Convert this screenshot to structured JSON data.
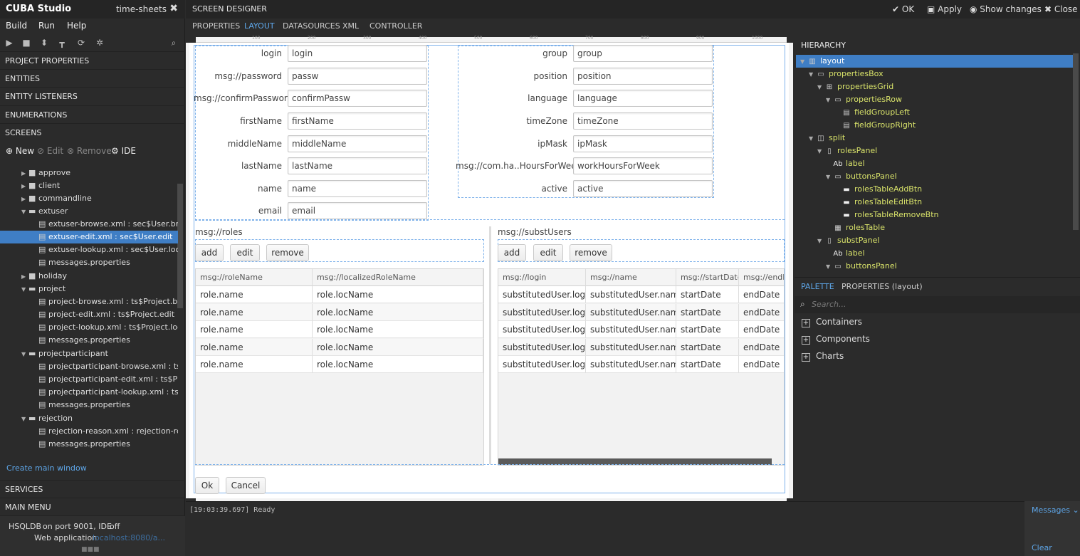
{
  "app": {
    "title": "CUBA Studio",
    "project_name": "time-sheets",
    "close_glyph": "✖"
  },
  "menu": {
    "build": "Build",
    "run": "Run",
    "help": "Help"
  },
  "left_sections": {
    "project_properties": "PROJECT PROPERTIES",
    "entities": "ENTITIES",
    "entity_listeners": "ENTITY LISTENERS",
    "enumerations": "ENUMERATIONS",
    "screens": "SCREENS",
    "services": "SERVICES",
    "main_menu": "MAIN MENU"
  },
  "screen_actions": {
    "new": "New",
    "edit": "Edit",
    "remove": "Remove",
    "ide": "IDE"
  },
  "tree": [
    "approve",
    "client",
    "commandline",
    "extuser",
    "extuser-browse.xml : sec$User.browse",
    "extuser-edit.xml : sec$User.edit",
    "extuser-lookup.xml : sec$User.lookup",
    "messages.properties",
    "holiday",
    "project",
    "project-browse.xml : ts$Project.browse",
    "project-edit.xml : ts$Project.edit",
    "project-lookup.xml : ts$Project.lookup",
    "messages.properties",
    "projectparticipant",
    "projectparticipant-browse.xml : ts$Pro",
    "projectparticipant-edit.xml : ts$Project",
    "projectparticipant-lookup.xml : ts$Proj",
    "messages.properties",
    "rejection",
    "rejection-reason.xml : rejection-reasor",
    "messages.properties"
  ],
  "create_main_window": "Create main window",
  "status": {
    "hsqldb": "HSQLDB",
    "hsqldb_info": "on port 9001, IDE",
    "hsqldb_state": "off",
    "web_app": "Web application",
    "web_app_link": "localhost:8080/a..."
  },
  "designer": {
    "title": "SCREEN DESIGNER",
    "ok": "OK",
    "apply": "Apply",
    "show_changes": "Show changes",
    "close": "Close",
    "tabs": [
      "PROPERTIES",
      "LAYOUT",
      "DATASOURCES",
      "XML",
      "CONTROLLER"
    ]
  },
  "form_left": [
    {
      "label": "login",
      "value": "login"
    },
    {
      "label": "msg://password",
      "value": "passw"
    },
    {
      "label": "msg://confirmPassword",
      "value": "confirmPassw"
    },
    {
      "label": "firstName",
      "value": "firstName"
    },
    {
      "label": "middleName",
      "value": "middleName"
    },
    {
      "label": "lastName",
      "value": "lastName"
    },
    {
      "label": "name",
      "value": "name"
    },
    {
      "label": "email",
      "value": "email"
    }
  ],
  "form_right": [
    {
      "label": "group",
      "value": "group"
    },
    {
      "label": "position",
      "value": "position"
    },
    {
      "label": "language",
      "value": "language"
    },
    {
      "label": "timeZone",
      "value": "timeZone"
    },
    {
      "label": "ipMask",
      "value": "ipMask"
    },
    {
      "label": "msg://com.ha..HoursForWeek",
      "value": "workHoursForWeek"
    },
    {
      "label": "active",
      "value": "active"
    }
  ],
  "roles_panel": {
    "caption": "msg://roles",
    "buttons": [
      "add",
      "edit",
      "remove"
    ],
    "columns": [
      "msg://roleName",
      "msg://localizedRoleName"
    ],
    "rows": [
      [
        "role.name",
        "role.locName"
      ],
      [
        "role.name",
        "role.locName"
      ],
      [
        "role.name",
        "role.locName"
      ],
      [
        "role.name",
        "role.locName"
      ],
      [
        "role.name",
        "role.locName"
      ]
    ]
  },
  "subst_panel": {
    "caption": "msg://substUsers",
    "buttons": [
      "add",
      "edit",
      "remove"
    ],
    "columns": [
      "msg://login",
      "msg://name",
      "msg://startDate",
      "msg://endDa"
    ],
    "rows": [
      [
        "substitutedUser.login",
        "substitutedUser.name",
        "startDate",
        "endDate"
      ],
      [
        "substitutedUser.login",
        "substitutedUser.name",
        "startDate",
        "endDate"
      ],
      [
        "substitutedUser.login",
        "substitutedUser.name",
        "startDate",
        "endDate"
      ],
      [
        "substitutedUser.login",
        "substitutedUser.name",
        "startDate",
        "endDate"
      ],
      [
        "substitutedUser.login",
        "substitutedUser.name",
        "startDate",
        "endDate"
      ]
    ]
  },
  "dialog_buttons": {
    "ok": "Ok",
    "cancel": "Cancel"
  },
  "ruler_ticks": [
    "100",
    "200",
    "300",
    "400",
    "500",
    "600",
    "700",
    "800",
    "900",
    "1000"
  ],
  "hierarchy": {
    "title": "HIERARCHY",
    "nodes": [
      {
        "label": "layout",
        "icon": "layout-icon"
      },
      {
        "label": "propertiesBox",
        "icon": "box-icon"
      },
      {
        "label": "propertiesGrid",
        "icon": "grid-icon"
      },
      {
        "label": "propertiesRow",
        "icon": "row-icon"
      },
      {
        "label": "fieldGroupLeft",
        "icon": "fieldgroup-icon"
      },
      {
        "label": "fieldGroupRight",
        "icon": "fieldgroup-icon"
      },
      {
        "label": "split",
        "icon": "split-icon"
      },
      {
        "label": "rolesPanel",
        "icon": "vbox-icon"
      },
      {
        "label": "label",
        "icon": "label-icon"
      },
      {
        "label": "buttonsPanel",
        "icon": "hbox-icon"
      },
      {
        "label": "rolesTableAddBtn",
        "icon": "button-icon"
      },
      {
        "label": "rolesTableEditBtn",
        "icon": "button-icon"
      },
      {
        "label": "rolesTableRemoveBtn",
        "icon": "button-icon"
      },
      {
        "label": "rolesTable",
        "icon": "table-icon"
      },
      {
        "label": "substPanel",
        "icon": "vbox-icon"
      },
      {
        "label": "label",
        "icon": "label-icon"
      },
      {
        "label": "buttonsPanel",
        "icon": "hbox-icon"
      }
    ]
  },
  "palette": {
    "tab_palette": "PALETTE",
    "tab_properties": "PROPERTIES (layout)",
    "search_placeholder": "Search...",
    "groups": [
      "Containers",
      "Components",
      "Charts"
    ]
  },
  "console": {
    "log": "[19:03:39.697] Ready",
    "messages": "Messages",
    "clear": "Clear"
  },
  "colors": {
    "accent": "#3f7ec5",
    "hierarchy_text": "#d9e36a",
    "link": "#5ea6e8"
  }
}
